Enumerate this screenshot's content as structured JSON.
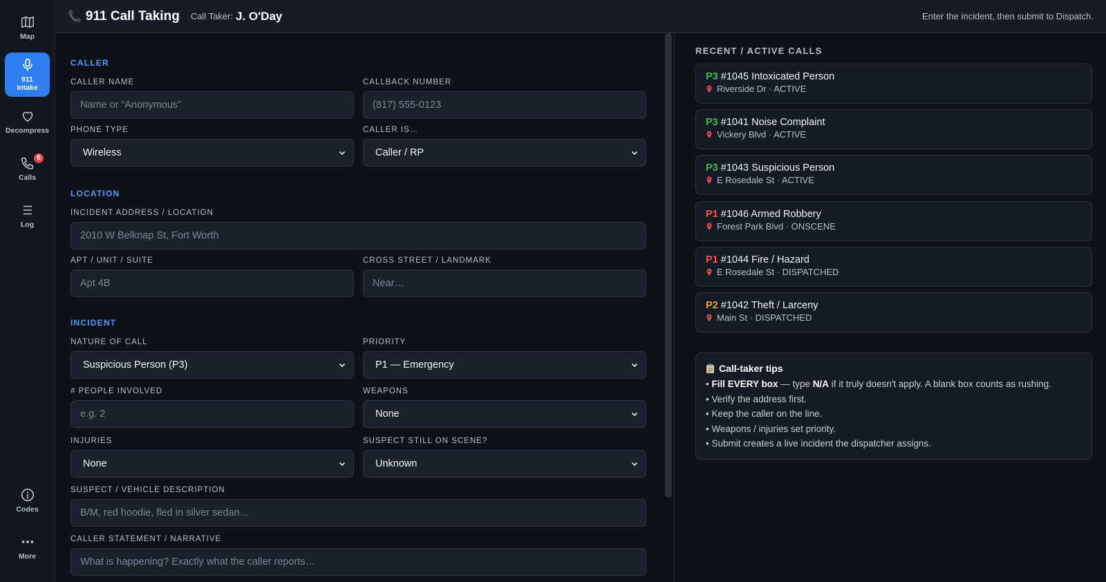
{
  "sidebar": {
    "items": [
      {
        "label": "Map",
        "icon": "map-icon"
      },
      {
        "label": "911\nIntake",
        "icon": "microphone-icon",
        "active": true
      },
      {
        "label": "Decompress",
        "icon": "heart-icon"
      },
      {
        "label": "Calls",
        "icon": "phone-icon",
        "badge": "6"
      },
      {
        "label": "Log",
        "icon": "list-icon"
      },
      {
        "label": "Codes",
        "icon": "info-icon"
      },
      {
        "label": "More",
        "icon": "more-icon"
      }
    ]
  },
  "header": {
    "title": "911 Call Taking",
    "taker_label": "Call Taker:",
    "taker_name": "J. O'Day",
    "hint": "Enter the incident, then submit to Dispatch."
  },
  "form": {
    "caller": {
      "section": "CALLER",
      "caller_name_label": "CALLER NAME",
      "caller_name_placeholder": "Name or “Anonymous”",
      "callback_label": "CALLBACK NUMBER",
      "callback_placeholder": "(817) 555-0123",
      "phone_type_label": "PHONE TYPE",
      "phone_type_value": "Wireless",
      "caller_is_label": "CALLER IS…",
      "caller_is_value": "Caller / RP"
    },
    "location": {
      "section": "LOCATION",
      "address_label": "INCIDENT ADDRESS / LOCATION",
      "address_placeholder": "2010 W Belknap St, Fort Worth",
      "apt_label": "APT / UNIT / SUITE",
      "apt_placeholder": "Apt 4B",
      "cross_label": "CROSS STREET / LANDMARK",
      "cross_placeholder": "Near…"
    },
    "incident": {
      "section": "INCIDENT",
      "nature_label": "NATURE OF CALL",
      "nature_value": "Suspicious Person (P3)",
      "priority_label": "PRIORITY",
      "priority_value": "P1 — Emergency",
      "people_label": "# PEOPLE INVOLVED",
      "people_placeholder": "e.g. 2",
      "weapons_label": "WEAPONS",
      "weapons_value": "None",
      "injuries_label": "INJURIES",
      "injuries_value": "None",
      "suspect_scene_label": "SUSPECT STILL ON SCENE?",
      "suspect_scene_value": "Unknown",
      "suspect_desc_label": "SUSPECT / VEHICLE DESCRIPTION",
      "suspect_desc_placeholder": "B/M, red hoodie, fled in silver sedan…",
      "narrative_label": "CALLER STATEMENT / NARRATIVE",
      "narrative_placeholder": "What is happening? Exactly what the caller reports…"
    }
  },
  "recent": {
    "title": "RECENT / ACTIVE CALLS",
    "calls": [
      {
        "priority": "P3",
        "title": "#1045 Intoxicated Person",
        "detail": "Riverside Dr · ACTIVE",
        "color": "#3fb950"
      },
      {
        "priority": "P3",
        "title": "#1041 Noise Complaint",
        "detail": "Vickery Blvd · ACTIVE",
        "color": "#3fb950"
      },
      {
        "priority": "P3",
        "title": "#1043 Suspicious Person",
        "detail": "E Rosedale St · ACTIVE",
        "color": "#3fb950"
      },
      {
        "priority": "P1",
        "title": "#1046 Armed Robbery",
        "detail": "Forest Park Blvd · ONSCENE",
        "color": "#f85149"
      },
      {
        "priority": "P1",
        "title": "#1044 Fire / Hazard",
        "detail": "E Rosedale St · DISPATCHED",
        "color": "#f85149"
      },
      {
        "priority": "P2",
        "title": "#1042 Theft / Larceny",
        "detail": "Main St · DISPATCHED",
        "color": "#f0a030"
      }
    ]
  },
  "tips": {
    "title": "Call-taker tips",
    "tip1_bold": "Fill EVERY box",
    "tip1_mid": " — type ",
    "tip1_na": "N/A",
    "tip1_rest": " if it truly doesn't apply. A blank box counts as rushing.",
    "tip2": "Verify the address first.",
    "tip3": "Keep the caller on the line.",
    "tip4": "Weapons / injuries set priority.",
    "tip5": "Submit creates a live incident the dispatcher assigns."
  },
  "colors": {
    "accent": "#2f7ff3",
    "section": "#4d9bff",
    "p1": "#f85149",
    "p2": "#f0a030",
    "p3": "#3fb950",
    "badge": "#e5484d"
  }
}
